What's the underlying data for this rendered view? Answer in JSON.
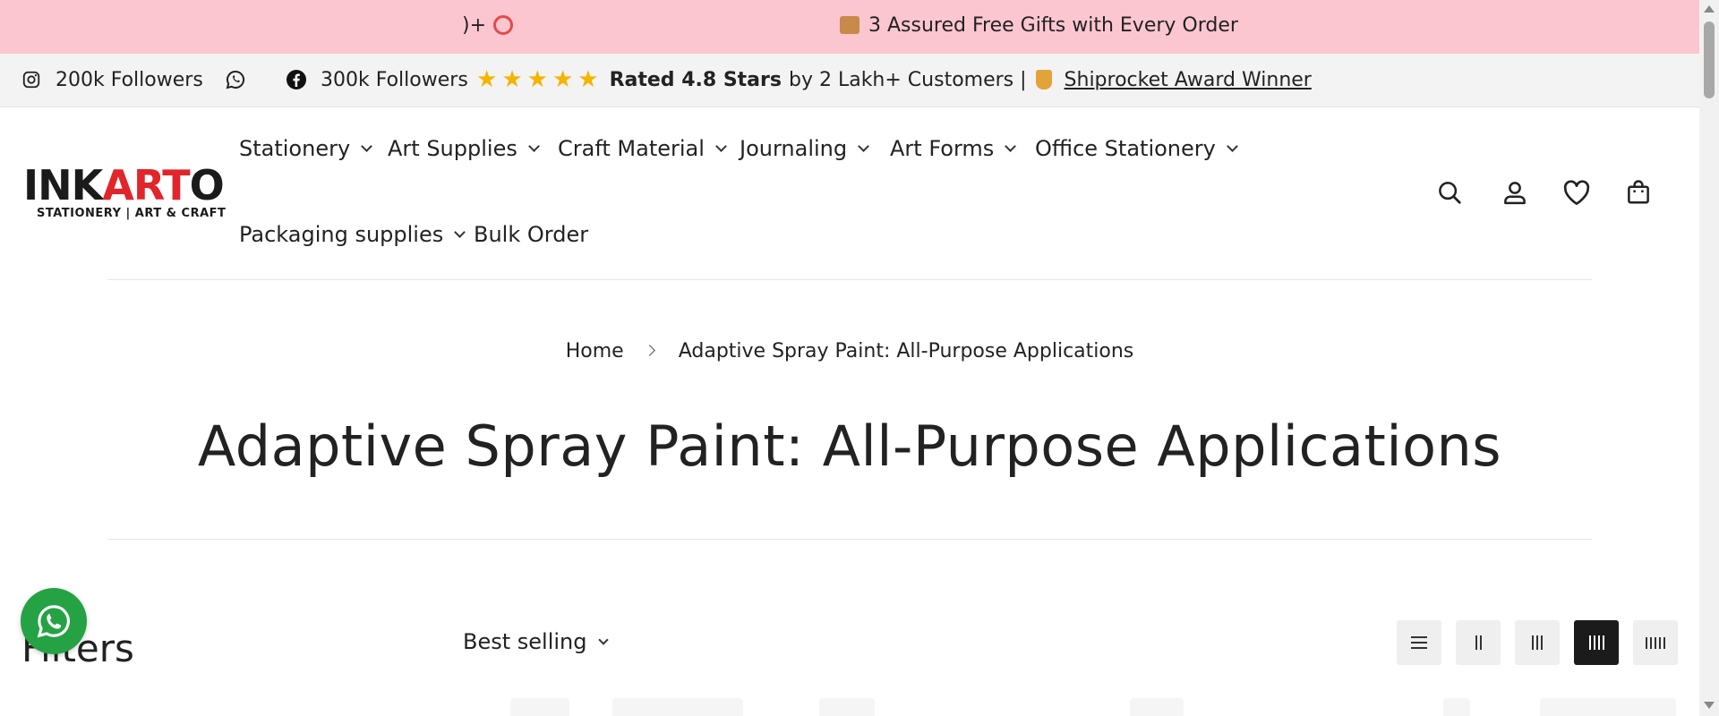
{
  "announcement": {
    "fragment_left": ")+",
    "fragment_left_icon": "alarm-clock-icon",
    "main_icon": "package-icon",
    "main_text": "3 Assured Free Gifts with Every Order"
  },
  "topbar": {
    "instagram_icon": "instagram-icon",
    "instagram_followers": "200k Followers",
    "whatsapp_icon": "whatsapp-icon",
    "facebook_icon": "facebook-icon",
    "facebook_followers": "300k Followers",
    "star_count": 5,
    "rating_bold": "Rated 4.8 Stars",
    "rating_rest": "by 2 Lakh+ Customers |",
    "trophy_icon": "trophy-icon",
    "award_link": "Shiprocket Award Winner"
  },
  "logo": {
    "part1": "INK",
    "part2": "ART",
    "part3": "O",
    "tagline": "STATIONERY | ART & CRAFT"
  },
  "nav": {
    "items": [
      {
        "label": "Stationery",
        "has_dropdown": true
      },
      {
        "label": "Art Supplies",
        "has_dropdown": true
      },
      {
        "label": "Craft Material",
        "has_dropdown": true
      },
      {
        "label": "Journaling",
        "has_dropdown": true
      },
      {
        "label": "Art Forms",
        "has_dropdown": true
      },
      {
        "label": "Office Stationery",
        "has_dropdown": true
      },
      {
        "label": "Packaging supplies",
        "has_dropdown": true
      },
      {
        "label": "Bulk Order",
        "has_dropdown": false
      }
    ]
  },
  "header_icons": [
    "search-icon",
    "account-icon",
    "wishlist-heart-icon",
    "cart-bag-icon"
  ],
  "breadcrumb": {
    "home": "Home",
    "current": "Adaptive Spray Paint: All-Purpose Applications"
  },
  "page": {
    "title": "Adaptive Spray Paint: All-Purpose Applications"
  },
  "toolbar": {
    "filters_label": "Filters",
    "sort_value": "Best selling",
    "view_options": [
      "list-view-icon",
      "grid-2-icon",
      "grid-3-icon",
      "grid-4-icon",
      "grid-5-icon"
    ],
    "active_view": "grid-4-icon"
  },
  "colors": {
    "announcement_bg": "#fcc6d0",
    "logo_red": "#e0252b",
    "whatsapp_green": "#25a244",
    "star_gold": "#f4b400"
  }
}
